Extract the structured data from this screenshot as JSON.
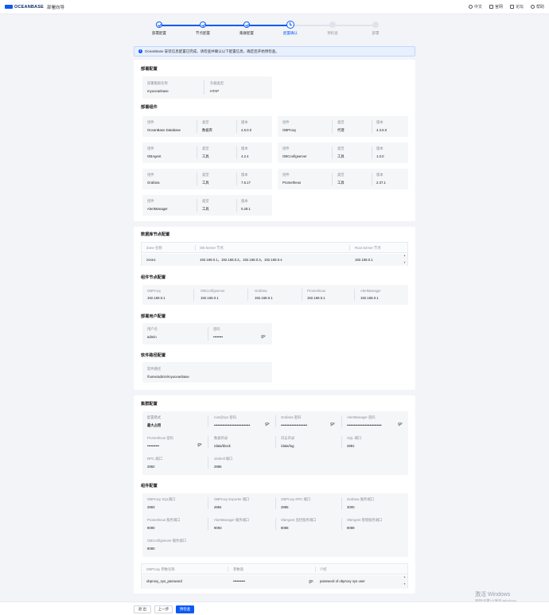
{
  "header": {
    "logo": "OCEANBASE",
    "app_name": "部署向导",
    "nav": [
      {
        "label": "中文",
        "icon": "globe-icon"
      },
      {
        "label": "官网",
        "icon": "home-icon"
      },
      {
        "label": "论坛",
        "icon": "forum-icon"
      },
      {
        "label": "帮助",
        "icon": "help-icon"
      }
    ]
  },
  "steps": [
    {
      "label": "部署配置",
      "state": "done"
    },
    {
      "label": "节点配置",
      "state": "done"
    },
    {
      "label": "集群配置",
      "state": "done"
    },
    {
      "label": "配置确认",
      "state": "current"
    },
    {
      "label": "预检查",
      "state": "todo"
    },
    {
      "label": "部署",
      "state": "todo"
    }
  ],
  "alert": {
    "icon": "info-icon",
    "text": "OceanBase 安装信息配置已完成，请检查并确认以下配置信息，确定后开始预检查。"
  },
  "deploy": {
    "title": "部署配置",
    "name_label": "部署集群名称",
    "name_value": "myoceanbase",
    "type_label": "负载类型",
    "type_value": "HTAP"
  },
  "components": {
    "title": "部署组件",
    "k_comp": "组件",
    "k_type": "类型",
    "k_ver": "版本",
    "items": [
      {
        "name": "OceanBase Database",
        "type": "数据库",
        "version": "4.5.0.0"
      },
      {
        "name": "OBProxy",
        "type": "代理",
        "version": "4.3.5.0"
      },
      {
        "name": "OBAgent",
        "type": "工具",
        "version": "4.2.4"
      },
      {
        "name": "OBConfigserver",
        "type": "工具",
        "version": "1.0.0"
      },
      {
        "name": "Grafana",
        "type": "工具",
        "version": "7.5.17"
      },
      {
        "name": "Prometheus",
        "type": "工具",
        "version": "2.37.1"
      },
      {
        "name": "AlertManager",
        "type": "工具",
        "version": "0.28.1"
      }
    ]
  },
  "db_nodes": {
    "title": "数据库节点配置",
    "headers": [
      "Zone 名称",
      "OB Server 节点",
      "Root Server 节点"
    ],
    "row": {
      "zone": "zone1",
      "servers": "192.168.0.1，192.168.0.2，192.168.0.3，192.168.0.4",
      "root": "192.168.0.1"
    }
  },
  "component_nodes": {
    "title": "组件节点配置",
    "items": [
      {
        "label": "OBProxy",
        "value": "192.168.0.1"
      },
      {
        "label": "OBConfigserver",
        "value": "192.168.0.1"
      },
      {
        "label": "Grafana",
        "value": "192.168.0.1"
      },
      {
        "label": "Prometheus",
        "value": "192.168.0.1"
      },
      {
        "label": "AlertManager",
        "value": "192.168.0.1"
      }
    ]
  },
  "deploy_user": {
    "title": "部署用户配置",
    "user_label": "用户名",
    "user_value": "admin",
    "pwd_label": "密码",
    "pwd_value": "••••••••"
  },
  "software_path": {
    "title": "软件路径配置",
    "label": "软件路径",
    "value": "/home/admin/myoceanbase"
  },
  "cluster": {
    "title": "集群配置",
    "row1": [
      {
        "label": "配置模式",
        "value": "最大占用"
      },
      {
        "label": "root@sys 密码",
        "value": "••••••••••••••••••••••••••••••"
      },
      {
        "label": "Grafana 密码",
        "value": "••••••••••••••••••••••"
      },
      {
        "label": "AlertManager 密码",
        "value": "•••••••••••••••••••••••••••••"
      }
    ],
    "row2": [
      {
        "label": "Prometheus 密码",
        "value": "••••••••••"
      },
      {
        "label": "数据目录",
        "value": "/data/block"
      },
      {
        "label": "日志目录",
        "value": "/data/log"
      },
      {
        "label": "SQL 端口",
        "value": "2881"
      }
    ],
    "row3": [
      {
        "label": "RPC 端口",
        "value": "2882"
      },
      {
        "label": "obshell 端口",
        "value": "2886"
      }
    ]
  },
  "component_config": {
    "title": "组件配置",
    "row1": [
      {
        "label": "OBProxy SQL端口",
        "value": "2883"
      },
      {
        "label": "OBProxy Exporter 端口",
        "value": "2884"
      },
      {
        "label": "OBProxy RPC 端口",
        "value": "2885"
      },
      {
        "label": "Grafana 服务端口",
        "value": "3000"
      }
    ],
    "row2": [
      {
        "label": "Prometheus 服务端口",
        "value": "9090"
      },
      {
        "label": "AlertManager 服务端口",
        "value": "9093"
      },
      {
        "label": "OBAgent 监控服务端口",
        "value": "8088"
      },
      {
        "label": "OBAgent 管理服务端口",
        "value": "8089"
      }
    ],
    "row3": [
      {
        "label": "OBConfigserver 服务端口",
        "value": "8080"
      }
    ]
  },
  "param_table": {
    "headers": [
      "OBProxy 参数名称",
      "参数值",
      "介绍"
    ],
    "row": {
      "name": "obproxy_sys_password",
      "value": "••••••••••",
      "desc": "password of obproxy sys user"
    }
  },
  "footer": {
    "exit": "退 出",
    "prev": "上一步",
    "next": "预检查"
  },
  "watermark": {
    "line1": "激活 Windows",
    "line2": "转到\"设置\"以激活 Windows。"
  }
}
